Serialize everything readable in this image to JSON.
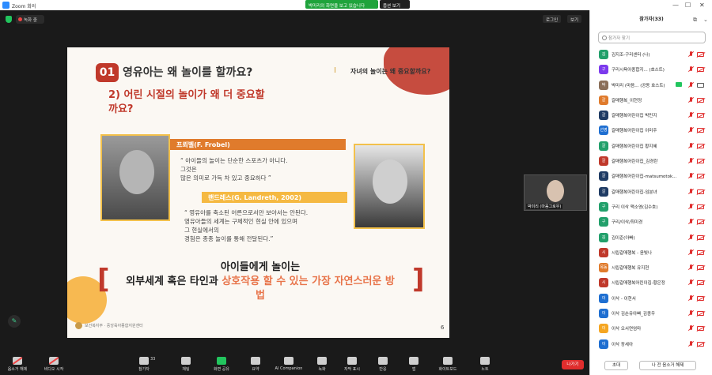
{
  "titlebar": {
    "app_title": "Zoom 회의",
    "share_banner": "박미리의 화면을 보고 있습니다",
    "options_label": "옵션 보기",
    "minimize": "—",
    "maximize": "☐",
    "close": "✕"
  },
  "meetbar": {
    "rec_label": "녹화 중",
    "zoom_label": "로그인",
    "view_label": "보기"
  },
  "slide": {
    "badge": "01",
    "title": "영유아는 왜 놀이를 할까요?",
    "side_title": "자녀의 놀이는 왜 중요할까요?",
    "subtitle_line1": "2) 어린 시절의 놀이가 왜 더 중요할",
    "subtitle_line2": "까요?",
    "froebel_name": "프뢰벨(F. Frobel)",
    "froebel_quote_1": "“ 아이들의 놀이는 단순한 스포츠가 아니다.",
    "froebel_quote_2": "그것은",
    "froebel_quote_3": "    많은 의미로 가득 차 있고 중요하다 ”",
    "landreth_name": "랜드레스(G. Landreth, 2002)",
    "landreth_quote_1": "“ 영유아를 축소된 어른으로서만 보아서는 안된다.",
    "landreth_quote_2": "   영유아들의 세계는 구체적인 현실 안에 있으며",
    "landreth_quote_3": "그 현실에서의",
    "landreth_quote_4": "    경험은 종종 놀이를 통해 전달된다.”",
    "concl_1": "아이들에게 놀이는",
    "concl_2a": "외부세계 혹은 타인과 ",
    "concl_2b": "상호작용 할 수 있는 가장 자연스러운 방",
    "concl_3": "법",
    "bracket_left": "[",
    "bracket_right": "]",
    "footer": "보건복지부 · 중앙육아종합지원센터",
    "page": "6"
  },
  "self_video": {
    "name": "박미리 (마음그로우)"
  },
  "toolbar": {
    "items": [
      {
        "label": "음소거 해제"
      },
      {
        "label": "비디오 시작"
      },
      {
        "label": "참가자"
      },
      {
        "label": "채팅"
      },
      {
        "label": "화면 공유"
      },
      {
        "label": "요약"
      },
      {
        "label": "AI Companion"
      },
      {
        "label": "녹화"
      },
      {
        "label": "자막 표시"
      },
      {
        "label": "반응"
      },
      {
        "label": "앱"
      },
      {
        "label": "화이트보드"
      },
      {
        "label": "노트"
      }
    ],
    "participant_count": "33",
    "leave_label": "나가기"
  },
  "panel": {
    "title": "참가자(33)",
    "search_placeholder": "참가자 찾기",
    "participants": [
      {
        "initial": "김",
        "color": "#22a06b",
        "name": "김지조-구리센터 (나)"
      },
      {
        "initial": "구",
        "color": "#7c3aed",
        "name": "구리시육아종합지... (호스트)"
      },
      {
        "initial": "박",
        "color": "#8b6f5a",
        "name": "박미리 (마음... (공동 호스트)"
      },
      {
        "initial": "갈",
        "color": "#e07b2c",
        "name": "갈매행복_이현정"
      },
      {
        "initial": "갈",
        "color": "#1f3b64",
        "name": "갈매행복어린이집 박민지"
      },
      {
        "initial": "선영",
        "color": "#1f6fd1",
        "name": "갈매행복어린이집 이미주"
      },
      {
        "initial": "갈",
        "color": "#22a06b",
        "name": "갈매행복어린이집 황지혜"
      },
      {
        "initial": "갈",
        "color": "#c0392b",
        "name": "갈매행복어린이집_김경란"
      },
      {
        "initial": "갈",
        "color": "#1f3b64",
        "name": "갈매행복어린이집-matsumotok..."
      },
      {
        "initial": "갈",
        "color": "#1f3b64",
        "name": "갈매행복어린이집-임분녀"
      },
      {
        "initial": "구",
        "color": "#22a06b",
        "name": "구리 이삭 맥소영(김수호)"
      },
      {
        "initial": "구",
        "color": "#22a06b",
        "name": "구리/이삭/최미경"
      },
      {
        "initial": "김",
        "color": "#22a06b",
        "name": "김이준(아빠)"
      },
      {
        "initial": "시",
        "color": "#c0392b",
        "name": "시립갈매행복 - 윤빛나"
      },
      {
        "initial": "목동",
        "color": "#e07b2c",
        "name": "시립갈매행복 유지현"
      },
      {
        "initial": "시",
        "color": "#c0392b",
        "name": "시립갈매행복어린이집-황은정"
      },
      {
        "initial": "이",
        "color": "#1f6fd1",
        "name": "이삭 - 이현서"
      },
      {
        "initial": "이",
        "color": "#1f6fd1",
        "name": "이삭 김순유아빠_김종우"
      },
      {
        "initial": "이",
        "color": "#f5a623",
        "name": "이삭 오서연엄마"
      },
      {
        "initial": "이",
        "color": "#1f6fd1",
        "name": "이삭 장세아"
      }
    ],
    "invite_label": "초대",
    "mute_all_label": "나 전 음소거 해제"
  },
  "colors": {
    "accent_red": "#c0392b",
    "accent_orange": "#e07b2c",
    "zoom_blue": "#2d8cff",
    "leave_red": "#e02d2d",
    "share_green": "#1fa33b"
  }
}
